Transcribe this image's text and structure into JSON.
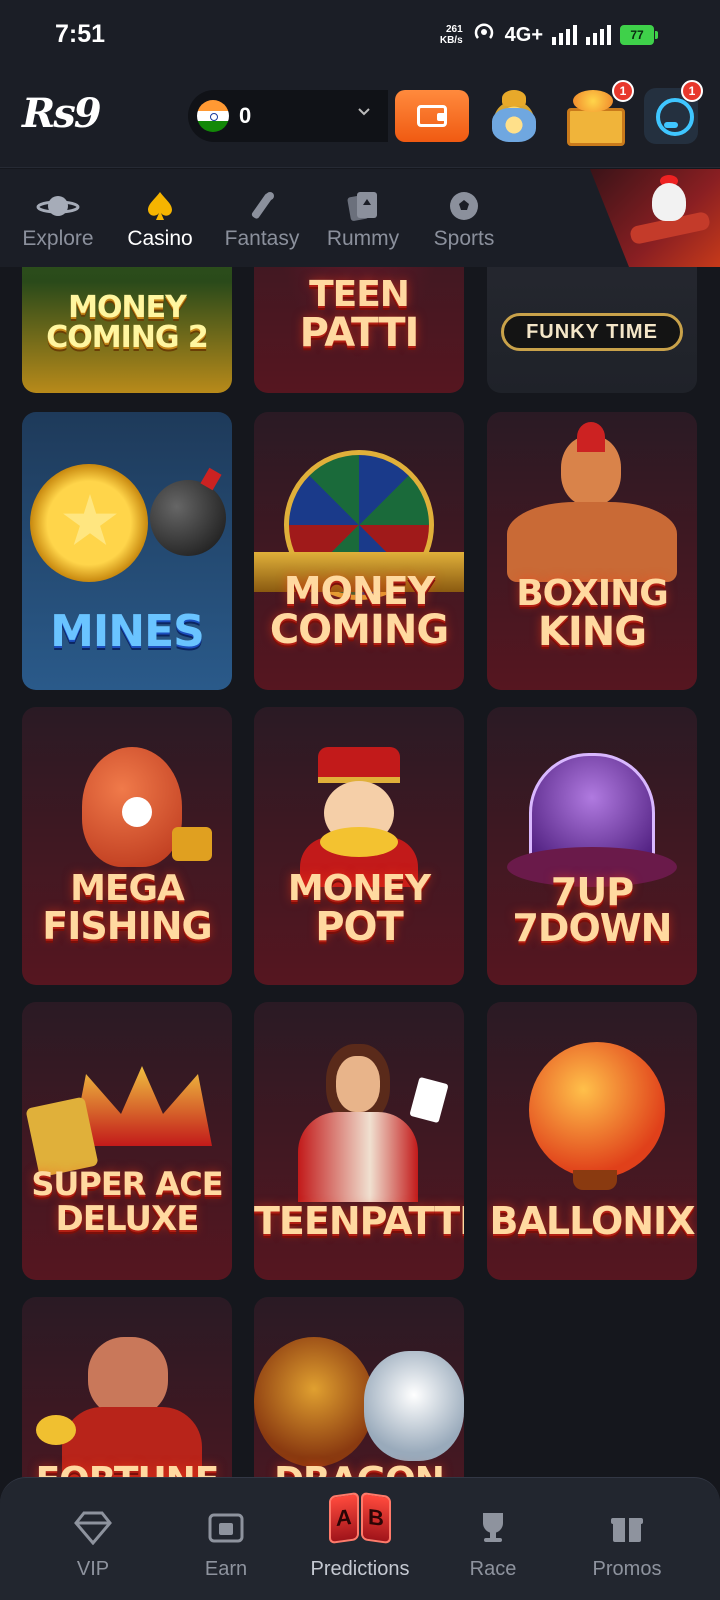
{
  "status": {
    "time": "7:51",
    "net_speed": "261",
    "net_speed_unit": "KB/s",
    "network": "4G+",
    "battery": "77"
  },
  "header": {
    "logo": "Rs9",
    "balance": "0",
    "badges": {
      "chest": "1",
      "support": "1"
    }
  },
  "categories": [
    {
      "label": "Explore",
      "icon": "planet-icon"
    },
    {
      "label": "Casino",
      "icon": "spade-icon",
      "active": true
    },
    {
      "label": "Fantasy",
      "icon": "fantasy-icon"
    },
    {
      "label": "Rummy",
      "icon": "cards-icon"
    },
    {
      "label": "Sports",
      "icon": "soccer-ball-icon"
    }
  ],
  "games": [
    {
      "line1": "MONEY",
      "line2": "COMING 2"
    },
    {
      "line1": "TEEN",
      "line2": "PATTI"
    },
    {
      "line1": "FUNKY TIME",
      "line2": ""
    },
    {
      "line1": "MINES",
      "line2": ""
    },
    {
      "line1": "MONEY",
      "line2": "COMING"
    },
    {
      "line1": "BOXING",
      "line2": "KING"
    },
    {
      "line1": "MEGA",
      "line2": "FISHING"
    },
    {
      "line1": "MONEY",
      "line2": "POT"
    },
    {
      "line1": "7UP",
      "line2": "7DOWN"
    },
    {
      "line1": "SUPER ACE",
      "line2": "DELUXE"
    },
    {
      "line1": "TEENPATTI",
      "line2": ""
    },
    {
      "line1": "BALLONIX",
      "line2": ""
    },
    {
      "line1": "FORTUNE",
      "line2": ""
    },
    {
      "line1": "DRAGON",
      "line2": ""
    }
  ],
  "bottom_nav": [
    {
      "label": "VIP",
      "icon": "diamond-icon"
    },
    {
      "label": "Earn",
      "icon": "earn-icon"
    },
    {
      "label": "Predictions",
      "icon": "ab-icon",
      "letters": [
        "A",
        "B"
      ]
    },
    {
      "label": "Race",
      "icon": "trophy-icon"
    },
    {
      "label": "Promos",
      "icon": "gift-icon"
    }
  ],
  "colors": {
    "bg": "#15171d",
    "accent": "#f5b400",
    "wallet": "#f26b1d",
    "badge": "#e8382c"
  }
}
